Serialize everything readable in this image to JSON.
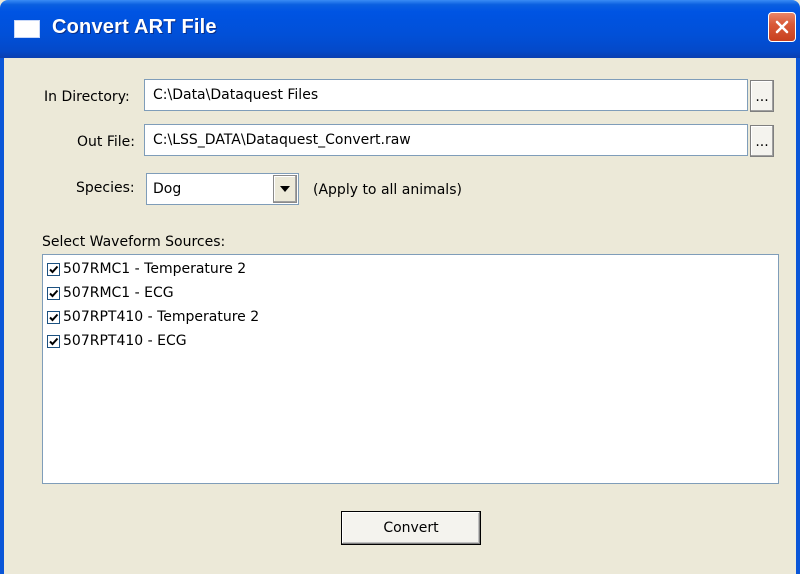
{
  "window": {
    "title": "Convert ART File"
  },
  "form": {
    "in_directory_label": "In Directory:",
    "in_directory_value": "C:\\Data\\Dataquest Files",
    "in_directory_browse": "...",
    "out_file_label": "Out File:",
    "out_file_value": "C:\\LSS_DATA\\Dataquest_Convert.raw",
    "out_file_browse": "...",
    "species_label": "Species:",
    "species_value": "Dog",
    "species_note": "(Apply to all animals)"
  },
  "sources": {
    "label": "Select Waveform Sources:",
    "items": [
      {
        "label": "507RMC1 - Temperature 2",
        "checked": true
      },
      {
        "label": "507RMC1 - ECG",
        "checked": true
      },
      {
        "label": "507RPT410 - Temperature 2",
        "checked": true
      },
      {
        "label": "507RPT410 - ECG",
        "checked": true
      }
    ]
  },
  "actions": {
    "convert_label": "Convert"
  },
  "icons": {
    "close": "close-icon",
    "window": "window-icon",
    "dropdown": "chevron-down-icon",
    "check": "checkmark-icon"
  }
}
